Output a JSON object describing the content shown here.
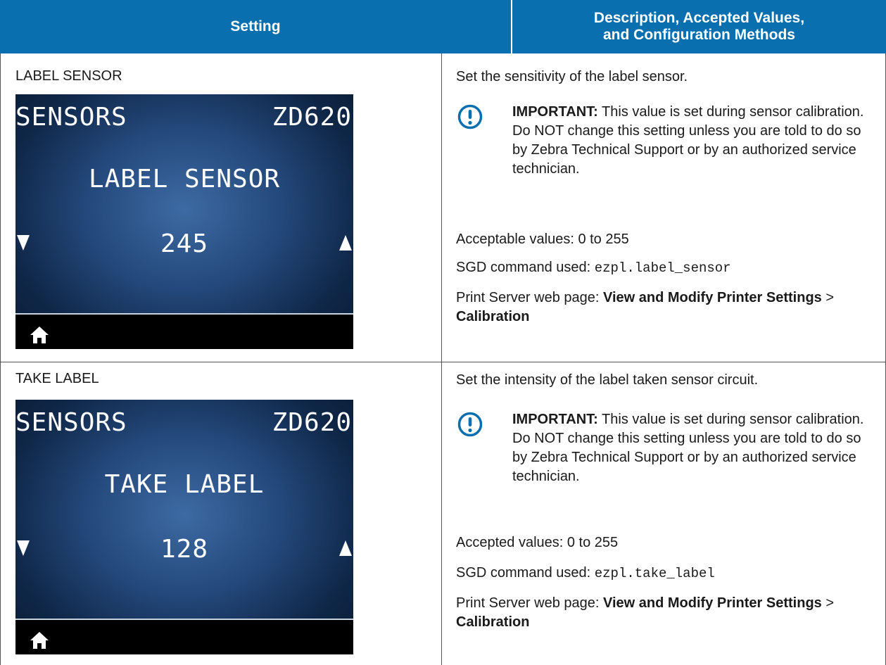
{
  "table": {
    "headers": {
      "setting": "Setting",
      "description_line1": "Description, Accepted Values,",
      "description_line2": "and Configuration Methods"
    },
    "rows": [
      {
        "setting_name": "LABEL SENSOR",
        "display": {
          "title": "SENSORS",
          "model": "ZD620",
          "name": "LABEL SENSOR",
          "value": "245"
        },
        "summary": "Set the sensitivity of the label sensor.",
        "important_label": "IMPORTANT:",
        "important_text": "This value is set during sensor calibration. Do NOT change this setting unless you are told to do so by Zebra Technical Support or by an authorized service technician.",
        "values_text": "Acceptable values: 0 to 255",
        "sgd_label": "SGD command used: ",
        "sgd_command": "ezpl.label_sensor",
        "web_label": "Print Server web page: ",
        "web_path1": "View and Modify Printer Settings",
        "web_sep": " > ",
        "web_path2": "Calibration"
      },
      {
        "setting_name": "TAKE LABEL",
        "display": {
          "title": "SENSORS",
          "model": "ZD620",
          "name": "TAKE LABEL",
          "value": "128"
        },
        "summary": "Set the intensity of the label taken sensor circuit.",
        "important_label": "IMPORTANT:",
        "important_text": "This value is set during sensor calibration. Do NOT change this setting unless you are told to do so by Zebra Technical Support or by an authorized service technician.",
        "values_text": "Accepted values: 0 to 255",
        "sgd_label": "SGD command used: ",
        "sgd_command": "ezpl.take_label",
        "web_label": "Print Server web page: ",
        "web_path1": "View and Modify Printer Settings",
        "web_sep": " > ",
        "web_path2": "Calibration"
      }
    ]
  },
  "colors": {
    "header_bg": "#0a6fae",
    "important_icon": "#0a6fae"
  },
  "icons": {
    "important": "exclamation-circle-icon",
    "home": "home-icon",
    "down": "triangle-down-icon",
    "up": "triangle-up-icon"
  }
}
